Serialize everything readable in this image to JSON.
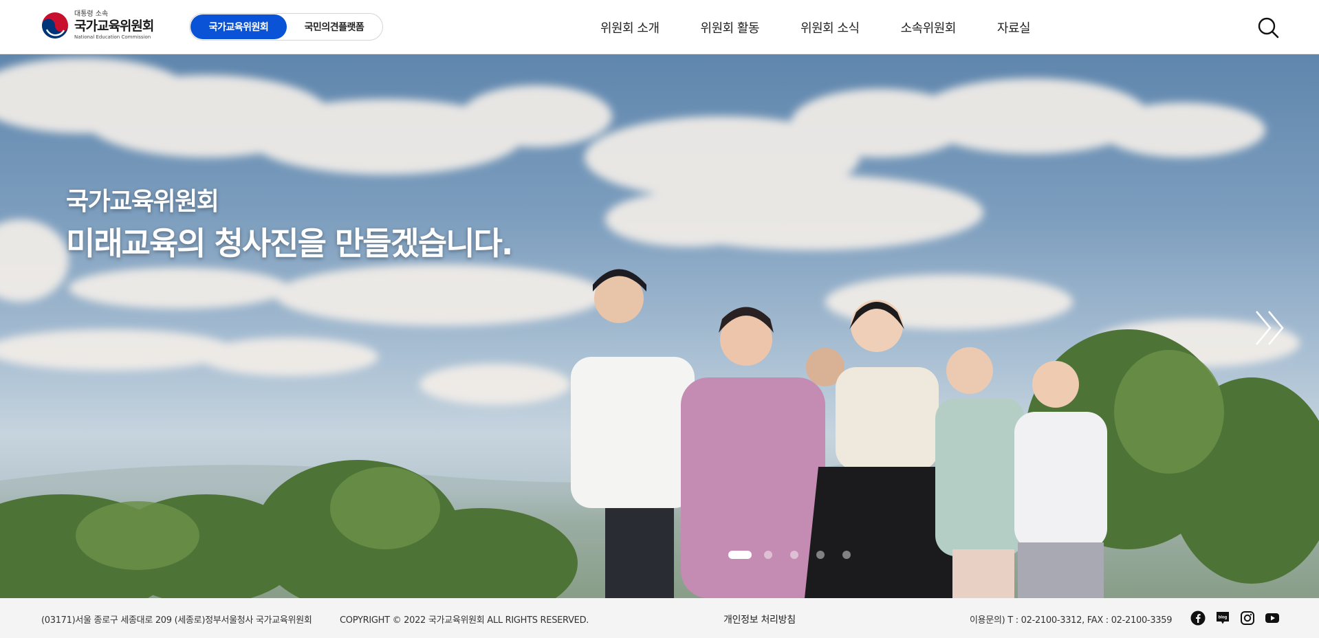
{
  "header": {
    "logo": {
      "sub": "대통령 소속",
      "main": "국가교육위원회",
      "en": "National Education Commission"
    },
    "toggle": {
      "active_label": "국가교육위원회",
      "inactive_label": "국민의견플랫폼"
    },
    "nav": [
      "위원회 소개",
      "위원회 활동",
      "위원회 소식",
      "소속위원회",
      "자료실"
    ],
    "search_icon": "search-icon"
  },
  "hero": {
    "title_small": "국가교육위원회",
    "title_large": "미래교육의 청사진을 만들겠습니다.",
    "slides_total": 5,
    "slide_active": 1,
    "next_icon": "double-chevron-right-icon"
  },
  "footer": {
    "address": "(03171)서울 종로구 세종대로 209 (세종로)정부서울청사 국가교육위원회",
    "copyright": "COPYRIGHT © 2022 국가교육위원회 ALL RIGHTS RESERVED.",
    "privacy": "개인정보 처리방침",
    "contact": "이용문의) T : 02-2100-3312, FAX : 02-2100-3359",
    "sns": [
      "facebook-icon",
      "blog-icon",
      "instagram-icon",
      "youtube-icon"
    ],
    "blog_icon_text": "blog"
  },
  "colors": {
    "accent": "#0a52d6",
    "logo_red": "#c8102e",
    "logo_blue": "#003478"
  }
}
